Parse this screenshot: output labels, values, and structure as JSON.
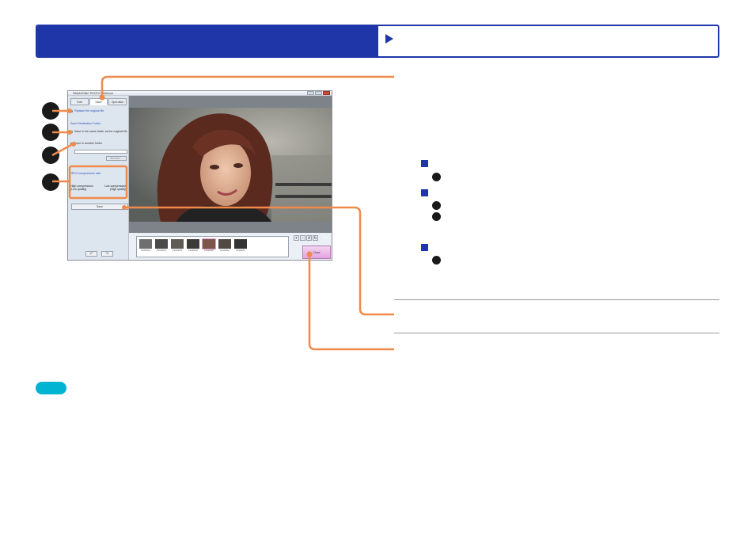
{
  "header": {
    "title": "",
    "subtitle": ""
  },
  "app_window": {
    "title": "PANASONIC PHOTO - Retouch",
    "tabs": [
      "Edit",
      "Save",
      "Operation"
    ],
    "options": {
      "replace_original": "Replace the original file",
      "destination_heading": "Save Destination Folder",
      "same_folder": "Save in the same folder as the original file",
      "another_folder": "Save in another folder",
      "browse": "Browse..."
    },
    "compression": {
      "heading": "JPEG compression rate",
      "high_compression": "High compression\n(Low quality)",
      "low_compression": "Low compression\n(High quality)"
    },
    "save_button": "Save",
    "close_button": "Close",
    "zoom_level": "40%",
    "thumbnail_labels": [
      "P1000001",
      "P1000002",
      "P1000003",
      "P1000004",
      "P1000005",
      "P1000006",
      "P1000007"
    ]
  },
  "colors": {
    "header_blue": "#1f36a8",
    "callout_orange": "#f08a4b",
    "hint_cyan": "#00b4d2"
  }
}
